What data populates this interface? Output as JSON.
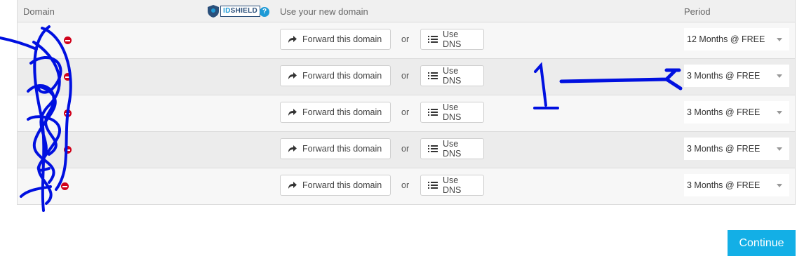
{
  "header": {
    "domain_label": "Domain",
    "idshield_id": "ID",
    "idshield_rest": "SHIELD",
    "help_symbol": "?",
    "use_label": "Use your new domain",
    "period_label": "Period"
  },
  "rows": [
    {
      "domain": "",
      "forward_label": "Forward this domain",
      "or_label": "or",
      "dns_label": "Use DNS",
      "period": "12 Months @ FREE"
    },
    {
      "domain": "",
      "forward_label": "Forward this domain",
      "or_label": "or",
      "dns_label": "Use DNS",
      "period": "3 Months @ FREE"
    },
    {
      "domain": "",
      "forward_label": "Forward this domain",
      "or_label": "or",
      "dns_label": "Use DNS",
      "period": "3 Months @ FREE"
    },
    {
      "domain": "",
      "forward_label": "Forward this domain",
      "or_label": "or",
      "dns_label": "Use DNS",
      "period": "3 Months @ FREE"
    },
    {
      "domain": "",
      "forward_label": "Forward this domain",
      "or_label": "or",
      "dns_label": "Use DNS",
      "period": "3 Months @ FREE"
    }
  ],
  "continue_label": "Continue",
  "annotation": {
    "number": "1",
    "color": "#0010e0"
  },
  "icons": {
    "forward": "share-arrow-icon",
    "dns": "list-icon",
    "remove": "minus-circle-icon",
    "help": "question-circle-icon",
    "brand": "idshield-logo"
  },
  "colors": {
    "continue_bg": "#13afe6",
    "remove": "#d0021b",
    "accent": "#1e9ad6"
  }
}
